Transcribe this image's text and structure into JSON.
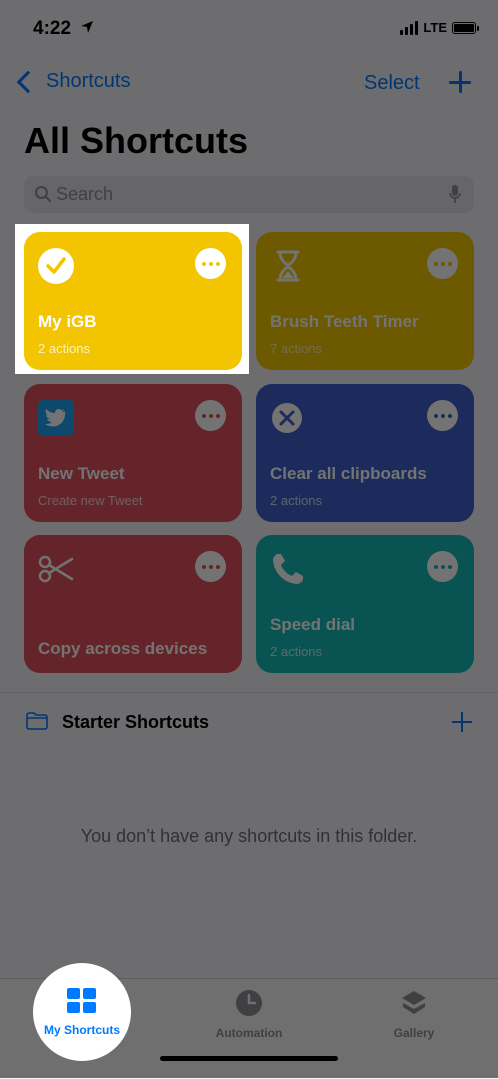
{
  "status_bar": {
    "time": "4:22",
    "network": "LTE"
  },
  "nav": {
    "back_label": "Shortcuts",
    "select_label": "Select"
  },
  "page_title": "All Shortcuts",
  "search": {
    "placeholder": "Search"
  },
  "shortcuts": [
    {
      "title": "My iGB",
      "subtitle": "2 actions",
      "color": "#f2c500",
      "icon": "checkmark-icon",
      "selected": true
    },
    {
      "title": "Brush Teeth Timer",
      "subtitle": "7 actions",
      "color": "#f2c500",
      "icon": "hourglass-icon"
    },
    {
      "title": "New Tweet",
      "subtitle": "Create new Tweet",
      "color": "#e0505b",
      "icon": "twitter-icon"
    },
    {
      "title": "Clear all clipboards",
      "subtitle": "2 actions",
      "color": "#3e5fc9",
      "icon": "close-circle-icon"
    },
    {
      "title": "Copy across devices",
      "subtitle": "",
      "color": "#e0505b",
      "icon": "scissors-icon"
    },
    {
      "title": "Speed dial",
      "subtitle": "2 actions",
      "color": "#16b9b7",
      "icon": "phone-icon"
    }
  ],
  "folder": {
    "label": "Starter Shortcuts"
  },
  "empty_message": "You don’t have any shortcuts in this folder.",
  "tabs": [
    {
      "label": "My Shortcuts",
      "icon": "grid-icon",
      "active": true
    },
    {
      "label": "Automation",
      "icon": "clock-check-icon",
      "active": false
    },
    {
      "label": "Gallery",
      "icon": "layers-icon",
      "active": false
    }
  ],
  "colors": {
    "accent": "#007aff",
    "inactive_tab": "#8e8e93"
  }
}
